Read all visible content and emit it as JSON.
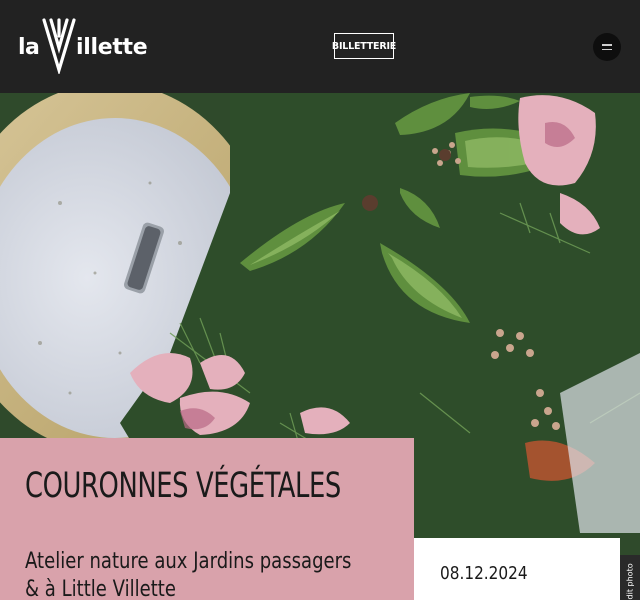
{
  "header": {
    "logo_prefix": "la",
    "logo_suffix": "illette",
    "ticket_label": "BILLETTERIE",
    "menu_icon": "hamburger-icon"
  },
  "hero": {
    "credit": "© Crédit photo"
  },
  "event": {
    "title": "COURONNES VÉGÉTALES",
    "subtitle": "Atelier nature aux Jardins passagers & à Little Villette",
    "date": "08.12.2024"
  },
  "colors": {
    "header_bg": "#222222",
    "card_pink": "#d9a2ab"
  }
}
